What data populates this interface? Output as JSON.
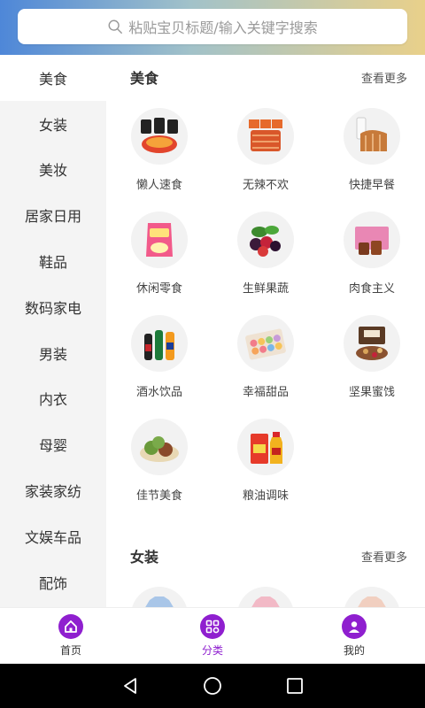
{
  "search": {
    "placeholder": "粘贴宝贝标题/输入关键字搜索"
  },
  "sidebar": {
    "items": [
      {
        "label": "美食",
        "active": true
      },
      {
        "label": "女装"
      },
      {
        "label": "美妆"
      },
      {
        "label": "居家日用"
      },
      {
        "label": "鞋品"
      },
      {
        "label": "数码家电"
      },
      {
        "label": "男装"
      },
      {
        "label": "内衣"
      },
      {
        "label": "母婴"
      },
      {
        "label": "家装家纺"
      },
      {
        "label": "文娱车品"
      },
      {
        "label": "配饰"
      }
    ]
  },
  "sections": [
    {
      "title": "美食",
      "more": "查看更多",
      "items": [
        {
          "label": "懒人速食",
          "icon": "instant-noodles-icon"
        },
        {
          "label": "无辣不欢",
          "icon": "spicy-snack-icon"
        },
        {
          "label": "快捷早餐",
          "icon": "bread-milk-icon"
        },
        {
          "label": "休闲零食",
          "icon": "chips-bag-icon"
        },
        {
          "label": "生鲜果蔬",
          "icon": "berries-icon"
        },
        {
          "label": "肉食主义",
          "icon": "meat-box-icon"
        },
        {
          "label": "酒水饮品",
          "icon": "drink-bottles-icon"
        },
        {
          "label": "幸福甜品",
          "icon": "macaron-box-icon"
        },
        {
          "label": "坚果蜜饯",
          "icon": "nuts-gift-box-icon"
        },
        {
          "label": "佳节美食",
          "icon": "rice-dumplings-icon"
        },
        {
          "label": "粮油调味",
          "icon": "rice-oil-icon"
        }
      ]
    },
    {
      "title": "女装",
      "more": "查看更多",
      "items": [
        {
          "label": "",
          "icon": "blue-shirt-icon"
        },
        {
          "label": "",
          "icon": "pink-coat-icon"
        },
        {
          "label": "",
          "icon": "beige-sweater-icon"
        }
      ]
    }
  ],
  "tabbar": {
    "items": [
      {
        "label": "首页",
        "icon": "home-icon"
      },
      {
        "label": "分类",
        "icon": "category-icon",
        "active": true
      },
      {
        "label": "我的",
        "icon": "user-icon"
      }
    ]
  },
  "colors": {
    "accent": "#8f1fcf",
    "sidebar_bg": "#f4f4f4"
  }
}
